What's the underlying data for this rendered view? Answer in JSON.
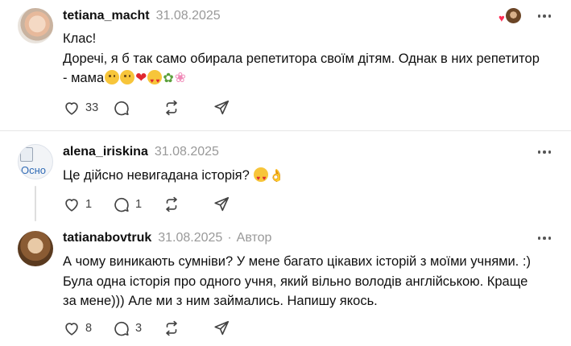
{
  "posts": [
    {
      "username": "tetiana_macht",
      "date": "31.08.2025",
      "text_line1": "Клас!",
      "text_line2": "Доречі, я б так само обирала репетитора своїм дітям. Однак в них репетитор",
      "text_line3": "- мама",
      "emojis": [
        "smiling-face",
        "rofl-face",
        "red-heart",
        "smiling-face-with-hearts",
        "bouquet",
        "cherry-blossom"
      ],
      "liked_by_author": true,
      "likes": "33",
      "replies": "",
      "reposts": "",
      "shares": ""
    },
    {
      "username": "alena_iriskina",
      "date": "31.08.2025",
      "avatar_alt": "Осно",
      "text_line1": "Це дійсно невигадана історія?",
      "emojis": [
        "smiling-face-with-hearts",
        "ok-hand"
      ],
      "likes": "1",
      "replies": "1"
    },
    {
      "username": "tatianabovtruk",
      "date": "31.08.2025",
      "separator": "·",
      "author_label": "Автор",
      "text_line1": "А чому виникають сумніви? У мене багато цікавих історій з моїми учнями. :)",
      "text_line2": "Була одна історія про одного учня, який вільно володів англійською. Краще",
      "text_line3": "за мене))) Але ми з ним займались. Напишу якось.",
      "likes": "8",
      "replies": "3"
    }
  ],
  "icons": {
    "like": "heart-outline-icon",
    "reply": "speech-bubble-icon",
    "repost": "repost-arrows-icon",
    "share": "paper-plane-icon",
    "more": "more-dots-icon"
  },
  "colors": {
    "text": "#0f0f0f",
    "muted": "#999999",
    "icon": "#424242",
    "divider": "#e6e6e6",
    "like_heart": "#ff2d55"
  }
}
